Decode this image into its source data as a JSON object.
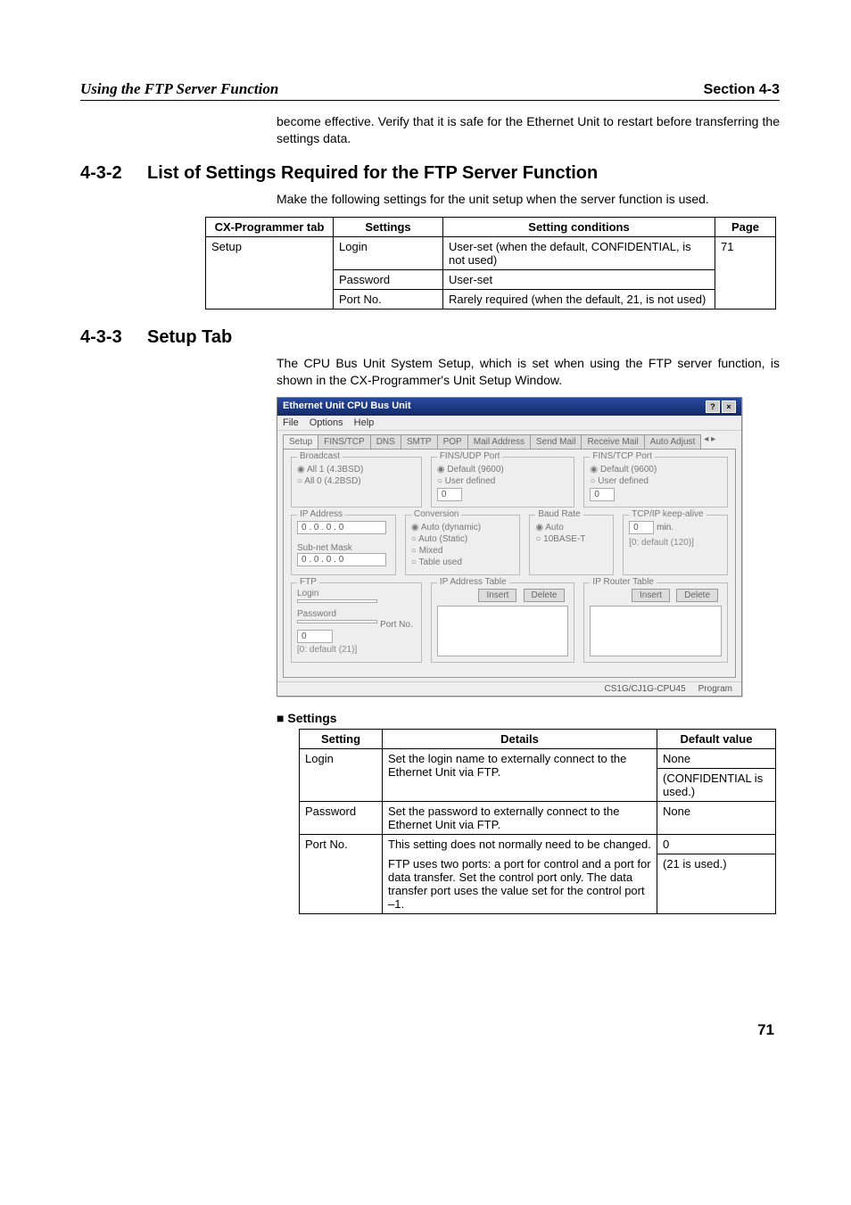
{
  "header": {
    "left": "Using the FTP Server Function",
    "right": "Section 4-3"
  },
  "intro_para": "become effective. Verify that it is safe for the Ethernet Unit to restart before transferring the settings data.",
  "section_432": {
    "num": "4-3-2",
    "title": "List of Settings Required for the FTP Server Function",
    "lead": "Make the following settings for the unit setup when the server function is used.",
    "table": {
      "headers": [
        "CX-Programmer tab",
        "Settings",
        "Setting conditions",
        "Page"
      ],
      "rows": [
        {
          "tab": "Setup",
          "setting": "Login",
          "cond": "User-set (when the default, CONFIDENTIAL, is not used)",
          "page": "71"
        },
        {
          "tab": "",
          "setting": "Password",
          "cond": "User-set",
          "page": ""
        },
        {
          "tab": "",
          "setting": "Port No.",
          "cond": "Rarely required (when the default, 21, is not used)",
          "page": ""
        }
      ]
    }
  },
  "section_433": {
    "num": "4-3-3",
    "title": "Setup Tab",
    "lead": "The CPU Bus Unit System Setup, which is set when using the FTP server function, is shown in the CX-Programmer's Unit Setup Window."
  },
  "screenshot": {
    "title": "Ethernet Unit CPU Bus Unit",
    "menus": [
      "File",
      "Options",
      "Help"
    ],
    "tabs": [
      "Setup",
      "FINS/TCP",
      "DNS",
      "SMTP",
      "POP",
      "Mail Address",
      "Send Mail",
      "Receive Mail",
      "Auto Adjust"
    ],
    "broadcast": {
      "legend": "Broadcast",
      "opts": [
        "All 1 (4.3BSD)",
        "All 0 (4.2BSD)"
      ],
      "sel": 0
    },
    "fins_udp": {
      "legend": "FINS/UDP Port",
      "opts": [
        "Default (9600)",
        "User defined"
      ],
      "sel": 0,
      "val": "0"
    },
    "fins_tcp": {
      "legend": "FINS/TCP Port",
      "opts": [
        "Default (9600)",
        "User defined"
      ],
      "sel": 0,
      "val": "0"
    },
    "ipaddr": {
      "legend": "IP Address",
      "val": "0 . 0 . 0 . 0",
      "sublegend": "Sub-net Mask",
      "subval": "0 . 0 . 0 . 0"
    },
    "conversion": {
      "legend": "Conversion",
      "opts": [
        "Auto (dynamic)",
        "Auto (Static)",
        "Mixed",
        "Table used"
      ],
      "sel": 0
    },
    "baud": {
      "legend": "Baud Rate",
      "opts": [
        "Auto",
        "10BASE-T"
      ],
      "sel": 0
    },
    "keepalive": {
      "legend": "TCP/IP keep-alive",
      "val": "0",
      "unit": "min.",
      "note": "[0: default (120)]"
    },
    "ftp": {
      "legend": "FTP",
      "login": "Login",
      "password": "Password",
      "portno": "Port No.",
      "portval": "0",
      "note": "[0: default (21)]"
    },
    "iptable": {
      "legend": "IP Address Table",
      "btn1": "Insert",
      "btn2": "Delete"
    },
    "routertable": {
      "legend": "IP Router Table",
      "btn1": "Insert",
      "btn2": "Delete"
    },
    "status_left": "CS1G/CJ1G-CPU45",
    "status_right": "Program"
  },
  "settings_block": {
    "label": "Settings",
    "headers": [
      "Setting",
      "Details",
      "Default value"
    ],
    "rows": [
      {
        "setting": "Login",
        "details": "Set the login name to externally connect to the Ethernet Unit via FTP.",
        "default": "None\n(CONFIDENTIAL is used.)"
      },
      {
        "setting": "Password",
        "details": "Set the password to externally connect to the Ethernet Unit via FTP.",
        "default": "None"
      },
      {
        "setting": "Port No.",
        "details_a": "This setting does not normally need to be changed.",
        "details_b": "FTP uses two ports: a port for control and a port for data transfer. Set the control port only. The data transfer port uses the value set for the control port –1.",
        "default": "0\n(21 is used.)"
      }
    ]
  },
  "page_number": "71"
}
